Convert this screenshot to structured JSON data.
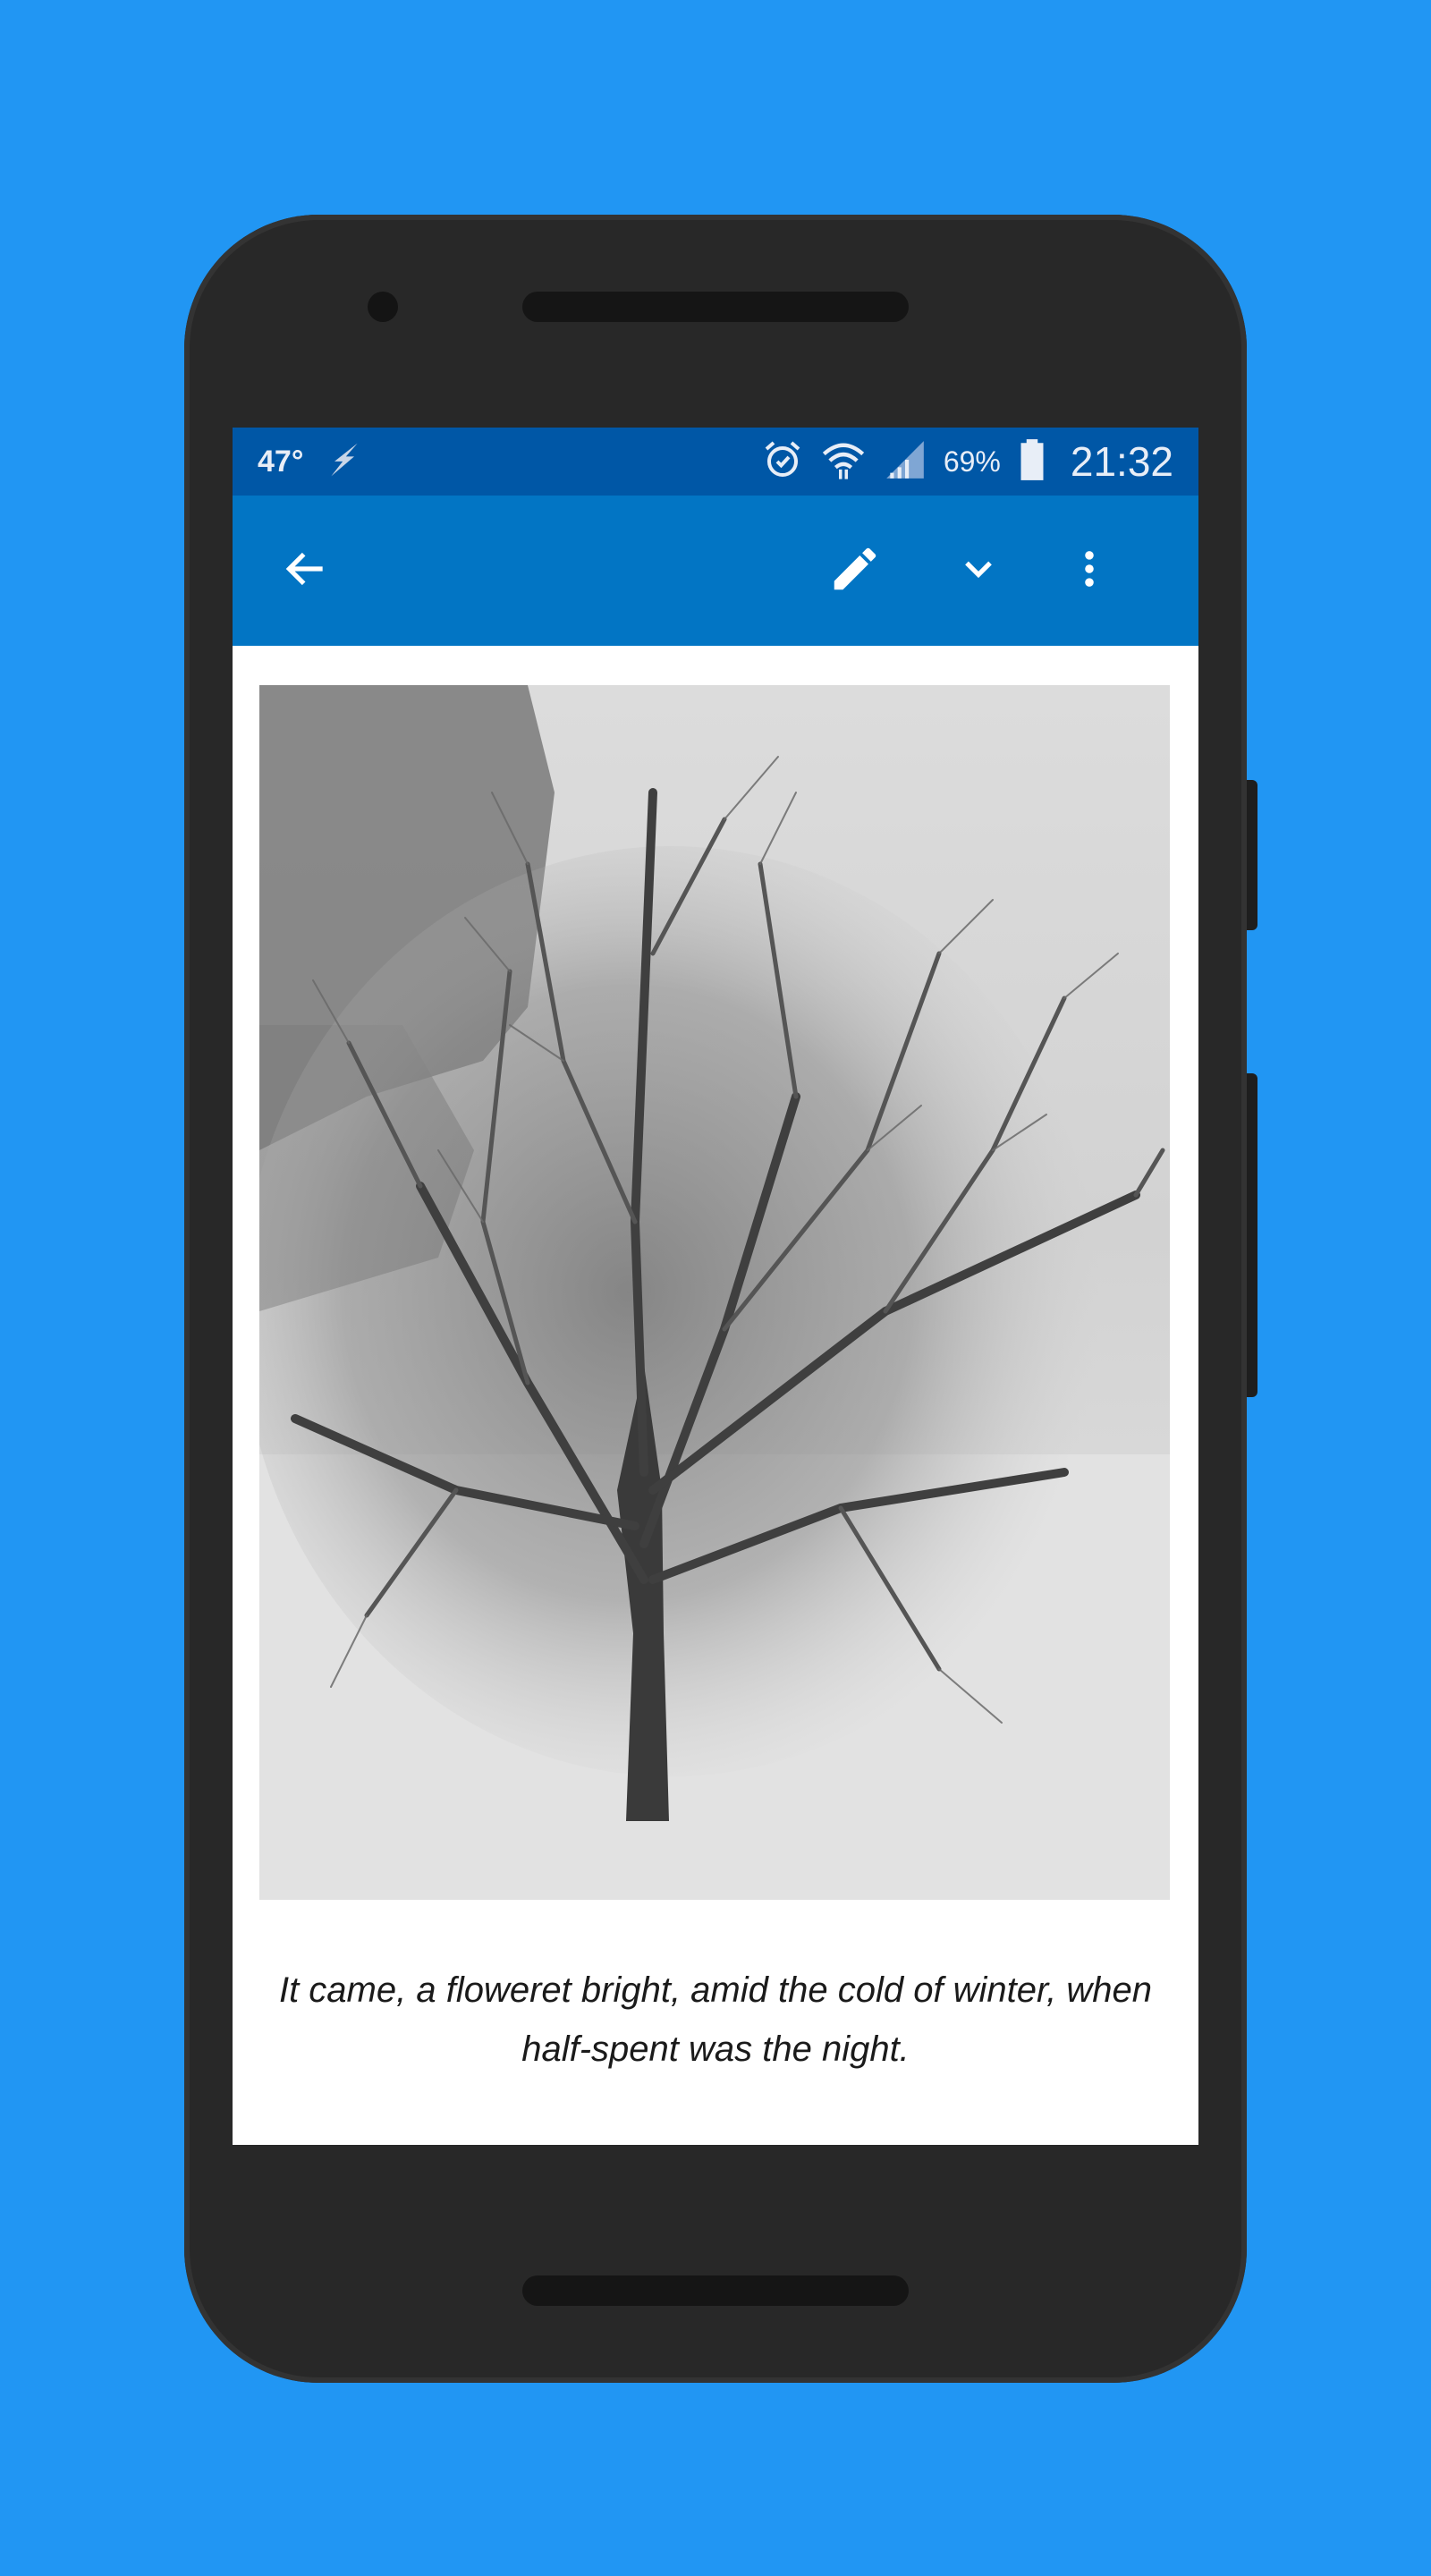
{
  "status_bar": {
    "temperature": "47°",
    "battery_percent": "69%",
    "time": "21:32",
    "icons": [
      "lightning-icon",
      "alarm-icon",
      "wifi-icon",
      "signal-icon",
      "battery-icon"
    ]
  },
  "app_bar": {
    "icons": [
      "back-arrow-icon",
      "edit-pencil-icon",
      "chevron-down-icon",
      "more-vert-icon"
    ]
  },
  "content": {
    "caption": "It came, a floweret bright, amid the cold of winter, when half-spent was the night."
  },
  "colors": {
    "background": "#2196f3",
    "status_bar": "#0057a6",
    "app_bar": "#0275c4",
    "phone_body": "#282828"
  }
}
